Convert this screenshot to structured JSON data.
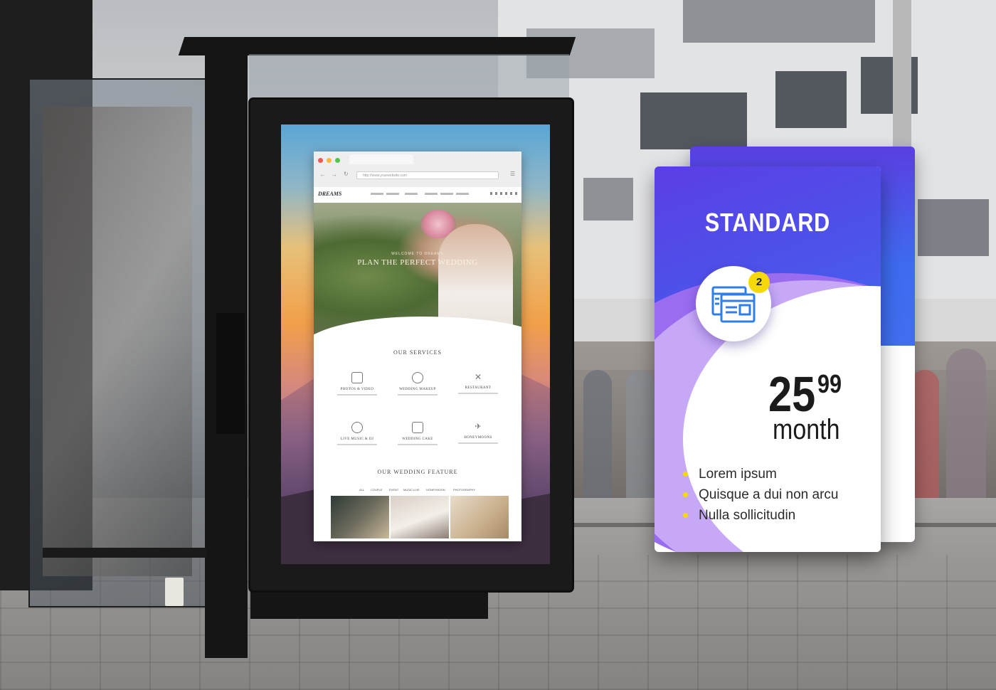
{
  "poster": {
    "browser": {
      "url": "http://www.yourwebsite.com",
      "logo": "DREAMS",
      "hero_kicker": "WELCOME TO DREAMS",
      "hero_title": "PLAN THE PERFECT WEDDING",
      "services_title": "OUR SERVICES",
      "services": [
        {
          "name": "PHOTOS & VIDEO",
          "icon": "camera-icon"
        },
        {
          "name": "WEDDING MAKEUP",
          "icon": "makeup-icon"
        },
        {
          "name": "RESTAURANT",
          "icon": "cutlery-icon"
        },
        {
          "name": "LIVE MUSIC & DJ",
          "icon": "music-icon"
        },
        {
          "name": "WEDDING CAKE",
          "icon": "cake-icon"
        },
        {
          "name": "HONEYMOONS",
          "icon": "plane-icon"
        }
      ],
      "features_title": "OUR WEDDING FEATURE",
      "feature_tabs": [
        "ALL",
        "COUPLE",
        "EVENT",
        "MUSIC LIVE",
        "HONEYMOON",
        "PHOTOGRAPHY"
      ]
    }
  },
  "pricing_card": {
    "title": "STANDARD",
    "badge": "2",
    "icon": "browser-windows-icon",
    "price_main": "25",
    "price_cents": "99",
    "price_unit": "month",
    "features": [
      "Lorem ipsum",
      "Quisque a dui non arcu",
      "Nulla sollicitudin"
    ],
    "colors": {
      "gradient_start": "#5b3ee6",
      "gradient_end": "#3f6ff0",
      "bullet": "#f5d90a",
      "icon": "#2f7fe8"
    }
  }
}
